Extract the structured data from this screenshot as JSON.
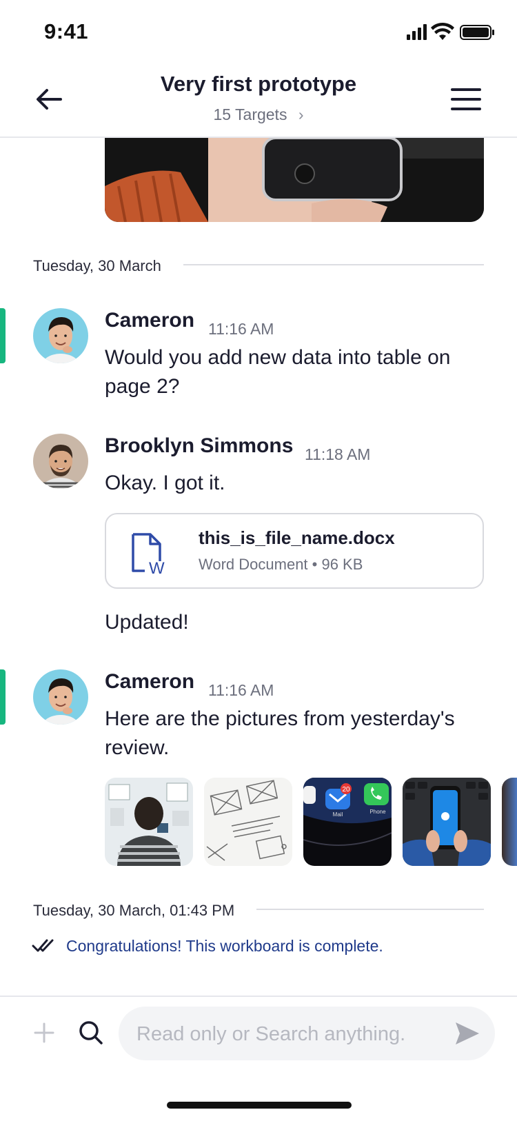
{
  "status_bar": {
    "time": "9:41"
  },
  "header": {
    "title": "Very first prototype",
    "subtitle": "15 Targets",
    "subtitle_chevron": "›"
  },
  "date_separators": [
    "Tuesday, 30 March",
    "Tuesday, 30 March, 01:43 PM"
  ],
  "messages": [
    {
      "author": "Cameron",
      "time": "11:16 AM",
      "text": "Would you add new data into table on page 2?"
    },
    {
      "author": "Brooklyn Simmons",
      "time": "11:18 AM",
      "text": "Okay. I got it.",
      "attachment": {
        "name": "this_is_file_name.docx",
        "meta": "Word Document • 96 KB",
        "icon_letter": "W",
        "icon": "word-file-icon"
      },
      "followup": "Updated!"
    },
    {
      "author": "Cameron",
      "time": "11:16 AM",
      "text": "Here are the pictures from yesterday's review."
    }
  ],
  "thumbnails": [
    {
      "name": "whiteboard-photo"
    },
    {
      "name": "wireframe-sketch-photo"
    },
    {
      "name": "phone-apps-photo",
      "badge": "20",
      "app_labels": [
        "Mail",
        "Phone"
      ]
    },
    {
      "name": "phone-in-hands-photo"
    }
  ],
  "completion": {
    "text": "Congratulations! This workboard is complete.",
    "icon": "double-check-icon"
  },
  "composer": {
    "placeholder": "Read only or Search anything."
  },
  "colors": {
    "accent": "#17b67f",
    "link_blue": "#1f3a8a",
    "file_icon": "#2f4ba8"
  }
}
